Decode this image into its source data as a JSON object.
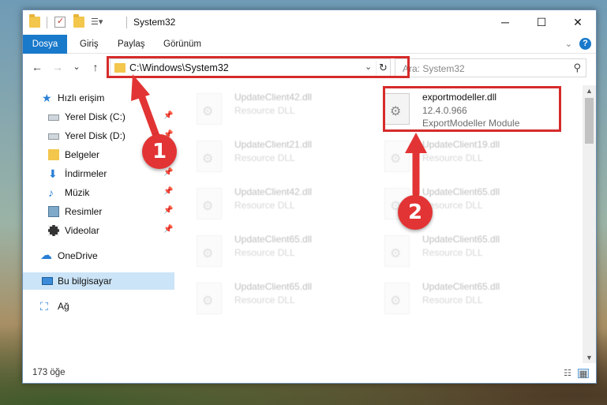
{
  "window": {
    "title": "System32",
    "controls": {
      "minimize": "─",
      "maximize": "☐",
      "close": "✕"
    }
  },
  "ribbon": {
    "tabs": [
      "Dosya",
      "Giriş",
      "Paylaş",
      "Görünüm"
    ],
    "active_tab": "Dosya",
    "expand_icon": "chevron-down-icon",
    "help": "?"
  },
  "navigation": {
    "back": "←",
    "forward": "→",
    "recent": "⌄",
    "up": "↑",
    "address": "C:\\Windows\\System32",
    "dropdown": "⌄",
    "refresh": "↻",
    "search_placeholder": "Ara: System32",
    "search_icon": "⚲"
  },
  "sidebar": {
    "items": [
      {
        "label": "Hızlı erişim",
        "icon": "star-icon",
        "glyph": "★",
        "pinned": false
      },
      {
        "label": "Yerel Disk (C:)",
        "icon": "drive-icon",
        "glyph": "",
        "pinned": true
      },
      {
        "label": "Yerel Disk (D:)",
        "icon": "drive-icon",
        "glyph": "",
        "pinned": true
      },
      {
        "label": "Belgeler",
        "icon": "documents-icon",
        "glyph": "",
        "pinned": true
      },
      {
        "label": "İndirmeler",
        "icon": "download-icon",
        "glyph": "⬇",
        "pinned": true
      },
      {
        "label": "Müzik",
        "icon": "music-icon",
        "glyph": "♪",
        "pinned": true
      },
      {
        "label": "Resimler",
        "icon": "pictures-icon",
        "glyph": "",
        "pinned": true
      },
      {
        "label": "Videolar",
        "icon": "video-icon",
        "glyph": "",
        "pinned": true
      },
      {
        "label": "OneDrive",
        "icon": "cloud-icon",
        "glyph": "☁",
        "pinned": false
      },
      {
        "label": "Bu bilgisayar",
        "icon": "computer-icon",
        "glyph": "",
        "pinned": false,
        "selected": true
      },
      {
        "label": "Ağ",
        "icon": "network-icon",
        "glyph": "⛶",
        "pinned": false
      }
    ]
  },
  "files": [
    {
      "name": "UpdateClient42.dll",
      "type": "Resource DLL",
      "faded": true
    },
    {
      "name": "exportmodeller.dll",
      "version": "12.4.0.966",
      "description": "ExportModeller Module",
      "faded": false,
      "highlighted": true
    },
    {
      "name": "UpdateClient21.dll",
      "type": "Resource DLL",
      "faded": true
    },
    {
      "name": "UpdateClient19.dll",
      "type": "Resource DLL",
      "faded": true
    },
    {
      "name": "UpdateClient42.dll",
      "type": "Resource DLL",
      "faded": true
    },
    {
      "name": "UpdateClient65.dll",
      "type": "Resource DLL",
      "faded": true
    },
    {
      "name": "UpdateClient65.dll",
      "type": "Resource DLL",
      "faded": true
    },
    {
      "name": "UpdateClient65.dll",
      "type": "Resource DLL",
      "faded": true
    },
    {
      "name": "UpdateClient65.dll",
      "type": "Resource DLL",
      "faded": true
    },
    {
      "name": "UpdateClient65.dll",
      "type": "Resource DLL",
      "faded": true
    }
  ],
  "status": {
    "item_count": "173 öğe",
    "view_details_icon": "details-view-icon",
    "view_tiles_icon": "tiles-view-icon"
  },
  "annotations": {
    "step1": "1",
    "step2": "2",
    "color": "#e23434"
  }
}
